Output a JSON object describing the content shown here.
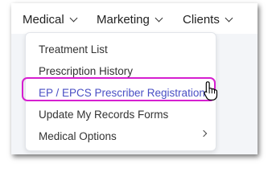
{
  "nav": {
    "items": [
      {
        "label": "Medical"
      },
      {
        "label": "Marketing"
      },
      {
        "label": "Clients"
      }
    ]
  },
  "dropdown": {
    "items": [
      {
        "label": "Treatment List"
      },
      {
        "label": "Prescription History"
      },
      {
        "label": "EP / EPCS Prescriber Registration"
      },
      {
        "label": "Update My Records Forms"
      },
      {
        "label": "Medical Options"
      }
    ]
  },
  "colors": {
    "highlight_border": "#d61fd0",
    "active_item_text": "#4a4fc4",
    "content_bg": "#f3f5f8"
  },
  "icons": {
    "nav_chevron": "chevron-down-icon",
    "submenu_arrow": "chevron-right-icon",
    "cursor": "hand-pointer-cursor-icon"
  }
}
